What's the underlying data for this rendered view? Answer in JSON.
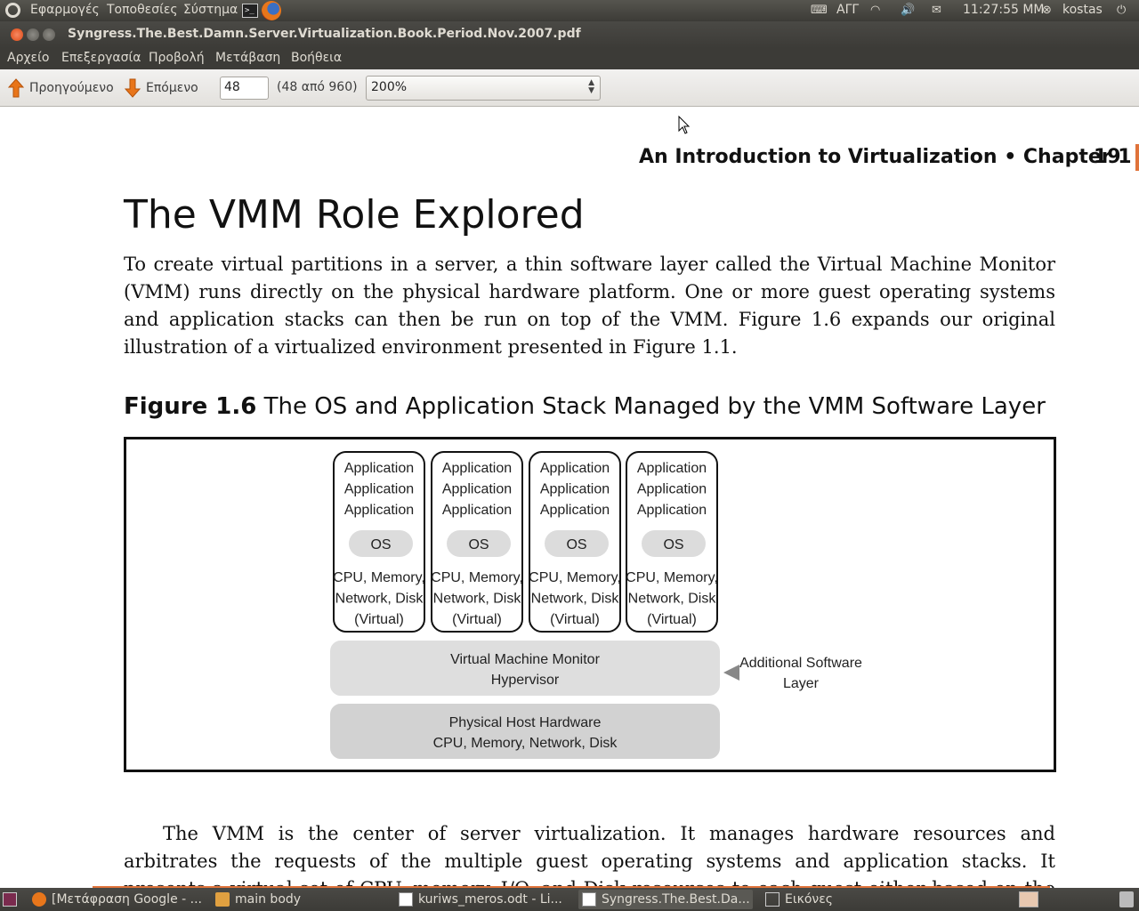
{
  "top_panel": {
    "menus": [
      "Εφαρμογές",
      "Τοποθεσίες",
      "Σύστημα"
    ],
    "keyboard_layout": "ΑΓΓ",
    "clock": "11:27:55 ΜΜ",
    "user": "kostas"
  },
  "window": {
    "title": "Syngress.The.Best.Damn.Server.Virtualization.Book.Period.Nov.2007.pdf"
  },
  "menubar": [
    "Αρχείο",
    "Επεξεργασία",
    "Προβολή",
    "Μετάβαση",
    "Βοήθεια"
  ],
  "toolbar": {
    "prev_label": "Προηγούμενο",
    "next_label": "Επόμενο",
    "page_value": "48",
    "page_count": "(48 από 960)",
    "zoom_value": "200%"
  },
  "document": {
    "running_head": "An Introduction to Virtualization • Chapter 1",
    "page_number": "19",
    "section_title": "The VMM Role Explored",
    "para1": "To create virtual partitions in a server, a thin software layer called the Virtual Machine Monitor (VMM) runs directly on the physical hardware platform. One or more guest operating systems and application stacks can then be run on top of the VMM. Figure 1.6 expands our original illustration of a virtualized environment presented in Figure 1.1.",
    "figure_label": "Figure 1.6",
    "figure_title": "The OS and Application Stack Managed by the VMM Software Layer",
    "para2": "The VMM is the center of server virtualization. It manages hardware resources and arbitrates the requests of the multiple guest operating systems and application stacks. It presents a virtual set of CPU, memory, I/O, and Disk resources to each guest either based on the actual physical hardware or"
  },
  "figure": {
    "vm_lines": [
      "Application",
      "Application",
      "Application"
    ],
    "os_label": "OS",
    "resources": [
      "CPU, Memory,",
      "Network, Disk",
      "(Virtual)"
    ],
    "vmm_lines": [
      "Virtual Machine Monitor",
      "Hypervisor"
    ],
    "hardware_lines": [
      "Physical Host Hardware",
      "CPU, Memory, Network, Disk"
    ],
    "annotation_lines": [
      "Additional Software",
      "Layer"
    ]
  },
  "taskbar": [
    "[Μετάφραση Google - ...",
    "main body",
    "kuriws_meros.odt - Li...",
    "Syngress.The.Best.Da...",
    "Εικόνες"
  ]
}
